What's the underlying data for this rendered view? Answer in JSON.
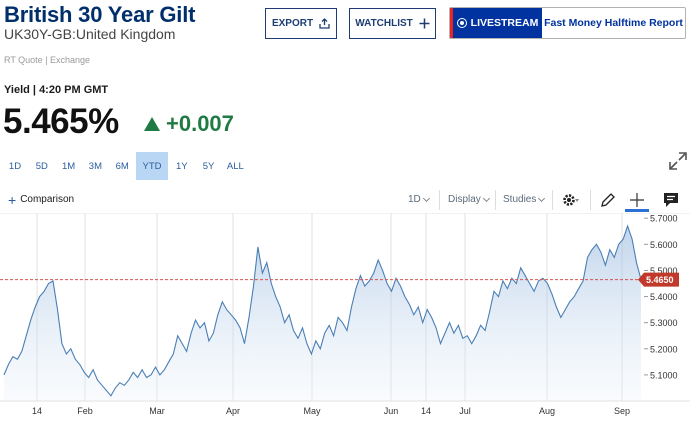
{
  "header": {
    "title": "British 30 Year Gilt",
    "subtitle": "UK30Y-GB:United Kingdom",
    "quote_source": "RT Quote | Exchange"
  },
  "actions": {
    "export_label": "EXPORT",
    "watchlist_label": "WATCHLIST",
    "livestream_label": "LIVESTREAM",
    "show_label": "Fast Money Halftime Report"
  },
  "quote": {
    "yield_label": "Yield | 4:20 PM GMT",
    "price": "5.465%",
    "change": "+0.007",
    "change_color": "#1f7a44"
  },
  "ranges": [
    "1D",
    "5D",
    "1M",
    "3M",
    "6M",
    "YTD",
    "1Y",
    "5Y",
    "ALL"
  ],
  "active_range": "YTD",
  "toolbar": {
    "comparison_label": "Comparison",
    "interval_label": "1D",
    "display_label": "Display",
    "studies_label": "Studies",
    "icons": [
      "gear-icon",
      "pencil-icon",
      "crosshair-icon",
      "comment-icon",
      "expand-icon"
    ]
  },
  "chart_data": {
    "type": "area",
    "x_labels": [
      "14",
      "Feb",
      "Mar",
      "Apr",
      "May",
      "Jun",
      "14",
      "Jul",
      "Aug",
      "Sep"
    ],
    "y_ticks": [
      "5.7000",
      "5.6000",
      "5.5000",
      "5.4000",
      "5.3000",
      "5.2000",
      "5.1000"
    ],
    "ylim": [
      5.0,
      5.72
    ],
    "current_value": "5.4650",
    "current_label_color": "#c0392b",
    "line_color": "#4a7fb5",
    "grid": "vertical",
    "values": [
      5.1,
      5.14,
      5.17,
      5.16,
      5.19,
      5.25,
      5.31,
      5.36,
      5.4,
      5.42,
      5.45,
      5.46,
      5.35,
      5.22,
      5.18,
      5.2,
      5.16,
      5.14,
      5.11,
      5.09,
      5.12,
      5.08,
      5.06,
      5.04,
      5.02,
      5.05,
      5.07,
      5.06,
      5.08,
      5.11,
      5.09,
      5.12,
      5.09,
      5.1,
      5.13,
      5.1,
      5.12,
      5.15,
      5.18,
      5.25,
      5.22,
      5.19,
      5.26,
      5.31,
      5.28,
      5.3,
      5.23,
      5.26,
      5.33,
      5.38,
      5.35,
      5.33,
      5.31,
      5.28,
      5.22,
      5.32,
      5.44,
      5.59,
      5.49,
      5.53,
      5.45,
      5.4,
      5.36,
      5.3,
      5.33,
      5.27,
      5.24,
      5.28,
      5.22,
      5.18,
      5.23,
      5.2,
      5.26,
      5.29,
      5.25,
      5.32,
      5.3,
      5.27,
      5.36,
      5.43,
      5.48,
      5.44,
      5.46,
      5.49,
      5.54,
      5.5,
      5.45,
      5.42,
      5.47,
      5.44,
      5.4,
      5.37,
      5.33,
      5.36,
      5.3,
      5.35,
      5.32,
      5.28,
      5.22,
      5.26,
      5.3,
      5.26,
      5.29,
      5.24,
      5.25,
      5.22,
      5.25,
      5.29,
      5.27,
      5.34,
      5.42,
      5.4,
      5.46,
      5.43,
      5.47,
      5.45,
      5.51,
      5.48,
      5.45,
      5.42,
      5.46,
      5.47,
      5.45,
      5.41,
      5.36,
      5.32,
      5.35,
      5.38,
      5.4,
      5.43,
      5.46,
      5.55,
      5.58,
      5.6,
      5.57,
      5.52,
      5.58,
      5.55,
      5.6,
      5.62,
      5.67,
      5.62,
      5.53,
      5.465
    ]
  }
}
